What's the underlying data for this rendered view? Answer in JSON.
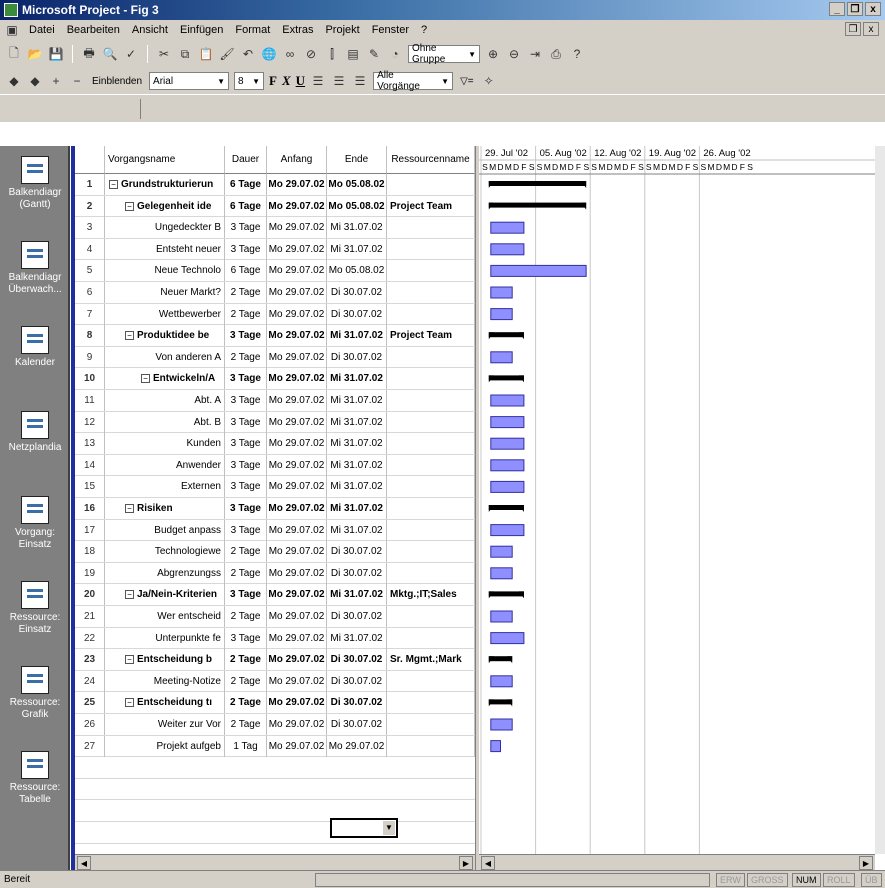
{
  "window": {
    "title": "Microsoft Project - Fig 3",
    "min": "_",
    "restore": "2",
    "close": "x"
  },
  "menu": [
    "Datei",
    "Bearbeiten",
    "Ansicht",
    "Einfügen",
    "Format",
    "Extras",
    "Projekt",
    "Fenster",
    "?"
  ],
  "toolbar1": {
    "group_value": "Ohne Gruppe"
  },
  "toolbar2": {
    "show_label": "Einblenden",
    "font_value": "Arial",
    "size_value": "8",
    "bold": "F",
    "italic": "X",
    "underline": "U",
    "filter_value": "Alle Vorgänge",
    "autofilter": "▽="
  },
  "viewbar": [
    {
      "label": "Balkendiagr (Gantt)",
      "name": "gantt"
    },
    {
      "label": "Balkendiagr Überwach...",
      "name": "tracking-gantt"
    },
    {
      "label": "Kalender",
      "name": "calendar"
    },
    {
      "label": "Netzplandia",
      "name": "network"
    },
    {
      "label": "Vorgang: Einsatz",
      "name": "task-usage"
    },
    {
      "label": "Ressource: Einsatz",
      "name": "resource-usage"
    },
    {
      "label": "Ressource: Grafik",
      "name": "resource-graph"
    },
    {
      "label": "Ressource: Tabelle",
      "name": "resource-sheet"
    }
  ],
  "columns": {
    "name": "Vorgangsname",
    "duration": "Dauer",
    "start": "Anfang",
    "end": "Ende",
    "resource": "Ressourcenname"
  },
  "tasks": [
    {
      "id": "1",
      "name": "Grundstrukturierun",
      "dur": "6 Tage",
      "start": "Mo 29.07.02",
      "end": "Mo 05.08.02",
      "res": "",
      "level": 0,
      "summary": true,
      "startDay": 0,
      "days": 6
    },
    {
      "id": "2",
      "name": "Gelegenheit ide",
      "dur": "6 Tage",
      "start": "Mo 29.07.02",
      "end": "Mo 05.08.02",
      "res": "Project Team",
      "level": 1,
      "summary": true,
      "startDay": 0,
      "days": 6
    },
    {
      "id": "3",
      "name": "Ungedeckter B",
      "dur": "3 Tage",
      "start": "Mo 29.07.02",
      "end": "Mi 31.07.02",
      "res": "",
      "level": 2,
      "summary": false,
      "startDay": 0,
      "days": 3
    },
    {
      "id": "4",
      "name": "Entsteht neuer",
      "dur": "3 Tage",
      "start": "Mo 29.07.02",
      "end": "Mi 31.07.02",
      "res": "",
      "level": 2,
      "summary": false,
      "startDay": 0,
      "days": 3
    },
    {
      "id": "5",
      "name": "Neue Technolo",
      "dur": "6 Tage",
      "start": "Mo 29.07.02",
      "end": "Mo 05.08.02",
      "res": "",
      "level": 2,
      "summary": false,
      "startDay": 0,
      "days": 6
    },
    {
      "id": "6",
      "name": "Neuer Markt?",
      "dur": "2 Tage",
      "start": "Mo 29.07.02",
      "end": "Di 30.07.02",
      "res": "",
      "level": 2,
      "summary": false,
      "startDay": 0,
      "days": 2
    },
    {
      "id": "7",
      "name": "Wettbewerber",
      "dur": "2 Tage",
      "start": "Mo 29.07.02",
      "end": "Di 30.07.02",
      "res": "",
      "level": 2,
      "summary": false,
      "startDay": 0,
      "days": 2
    },
    {
      "id": "8",
      "name": "Produktidee be",
      "dur": "3 Tage",
      "start": "Mo 29.07.02",
      "end": "Mi 31.07.02",
      "res": "Project Team",
      "level": 1,
      "summary": true,
      "startDay": 0,
      "days": 3
    },
    {
      "id": "9",
      "name": "Von anderen A",
      "dur": "2 Tage",
      "start": "Mo 29.07.02",
      "end": "Di 30.07.02",
      "res": "",
      "level": 2,
      "summary": false,
      "startDay": 0,
      "days": 2
    },
    {
      "id": "10",
      "name": "Entwickeln/A",
      "dur": "3 Tage",
      "start": "Mo 29.07.02",
      "end": "Mi 31.07.02",
      "res": "",
      "level": 2,
      "summary": true,
      "startDay": 0,
      "days": 3
    },
    {
      "id": "11",
      "name": "Abt. A",
      "dur": "3 Tage",
      "start": "Mo 29.07.02",
      "end": "Mi 31.07.02",
      "res": "",
      "level": 3,
      "summary": false,
      "startDay": 0,
      "days": 3
    },
    {
      "id": "12",
      "name": "Abt. B",
      "dur": "3 Tage",
      "start": "Mo 29.07.02",
      "end": "Mi 31.07.02",
      "res": "",
      "level": 3,
      "summary": false,
      "startDay": 0,
      "days": 3
    },
    {
      "id": "13",
      "name": "Kunden",
      "dur": "3 Tage",
      "start": "Mo 29.07.02",
      "end": "Mi 31.07.02",
      "res": "",
      "level": 3,
      "summary": false,
      "startDay": 0,
      "days": 3
    },
    {
      "id": "14",
      "name": "Anwender",
      "dur": "3 Tage",
      "start": "Mo 29.07.02",
      "end": "Mi 31.07.02",
      "res": "",
      "level": 3,
      "summary": false,
      "startDay": 0,
      "days": 3
    },
    {
      "id": "15",
      "name": "Externen",
      "dur": "3 Tage",
      "start": "Mo 29.07.02",
      "end": "Mi 31.07.02",
      "res": "",
      "level": 3,
      "summary": false,
      "startDay": 0,
      "days": 3
    },
    {
      "id": "16",
      "name": "Risiken",
      "dur": "3 Tage",
      "start": "Mo 29.07.02",
      "end": "Mi 31.07.02",
      "res": "",
      "level": 1,
      "summary": true,
      "startDay": 0,
      "days": 3
    },
    {
      "id": "17",
      "name": "Budget anpass",
      "dur": "3 Tage",
      "start": "Mo 29.07.02",
      "end": "Mi 31.07.02",
      "res": "",
      "level": 2,
      "summary": false,
      "startDay": 0,
      "days": 3
    },
    {
      "id": "18",
      "name": "Technologiewe",
      "dur": "2 Tage",
      "start": "Mo 29.07.02",
      "end": "Di 30.07.02",
      "res": "",
      "level": 2,
      "summary": false,
      "startDay": 0,
      "days": 2
    },
    {
      "id": "19",
      "name": "Abgrenzungss",
      "dur": "2 Tage",
      "start": "Mo 29.07.02",
      "end": "Di 30.07.02",
      "res": "",
      "level": 2,
      "summary": false,
      "startDay": 0,
      "days": 2
    },
    {
      "id": "20",
      "name": "Ja/Nein-Kriterien",
      "dur": "3 Tage",
      "start": "Mo 29.07.02",
      "end": "Mi 31.07.02",
      "res": "Mktg.;IT;Sales",
      "level": 1,
      "summary": true,
      "startDay": 0,
      "days": 3
    },
    {
      "id": "21",
      "name": "Wer entscheid",
      "dur": "2 Tage",
      "start": "Mo 29.07.02",
      "end": "Di 30.07.02",
      "res": "",
      "level": 2,
      "summary": false,
      "startDay": 0,
      "days": 2
    },
    {
      "id": "22",
      "name": "Unterpunkte fe",
      "dur": "3 Tage",
      "start": "Mo 29.07.02",
      "end": "Mi 31.07.02",
      "res": "",
      "level": 2,
      "summary": false,
      "startDay": 0,
      "days": 3
    },
    {
      "id": "23",
      "name": "Entscheidung b",
      "dur": "2 Tage",
      "start": "Mo 29.07.02",
      "end": "Di 30.07.02",
      "res": "Sr. Mgmt.;Mark",
      "level": 1,
      "summary": true,
      "startDay": 0,
      "days": 2
    },
    {
      "id": "24",
      "name": "Meeting-Notize",
      "dur": "2 Tage",
      "start": "Mo 29.07.02",
      "end": "Di 30.07.02",
      "res": "",
      "level": 2,
      "summary": false,
      "startDay": 0,
      "days": 2
    },
    {
      "id": "25",
      "name": "Entscheidung tı",
      "dur": "2 Tage",
      "start": "Mo 29.07.02",
      "end": "Di 30.07.02",
      "res": "",
      "level": 1,
      "summary": true,
      "startDay": 0,
      "days": 2
    },
    {
      "id": "26",
      "name": "Weiter zur Vor",
      "dur": "2 Tage",
      "start": "Mo 29.07.02",
      "end": "Di 30.07.02",
      "res": "",
      "level": 2,
      "summary": false,
      "startDay": 0,
      "days": 2
    },
    {
      "id": "27",
      "name": "Projekt aufgeb",
      "dur": "1 Tag",
      "start": "Mo 29.07.02",
      "end": "Mo 29.07.02",
      "res": "",
      "level": 2,
      "summary": false,
      "startDay": 0,
      "days": 1
    }
  ],
  "timescale": {
    "weeks": [
      "29. Jul '02",
      "05. Aug '02",
      "12. Aug '02",
      "19. Aug '02",
      "26. Aug '02"
    ],
    "days": [
      "S",
      "M",
      "D",
      "M",
      "D",
      "F",
      "S"
    ]
  },
  "status": {
    "text": "Bereit",
    "indicators": [
      {
        "label": "ERW",
        "on": false
      },
      {
        "label": "GROSS",
        "on": false
      },
      {
        "label": "NUM",
        "on": true
      },
      {
        "label": "ROLL",
        "on": false
      },
      {
        "label": "ÜB",
        "on": false
      }
    ]
  },
  "colors": {
    "task_bar": "#8f8fff",
    "summary_bar": "#000000",
    "viewbar_accent": "#1f2fa0"
  }
}
